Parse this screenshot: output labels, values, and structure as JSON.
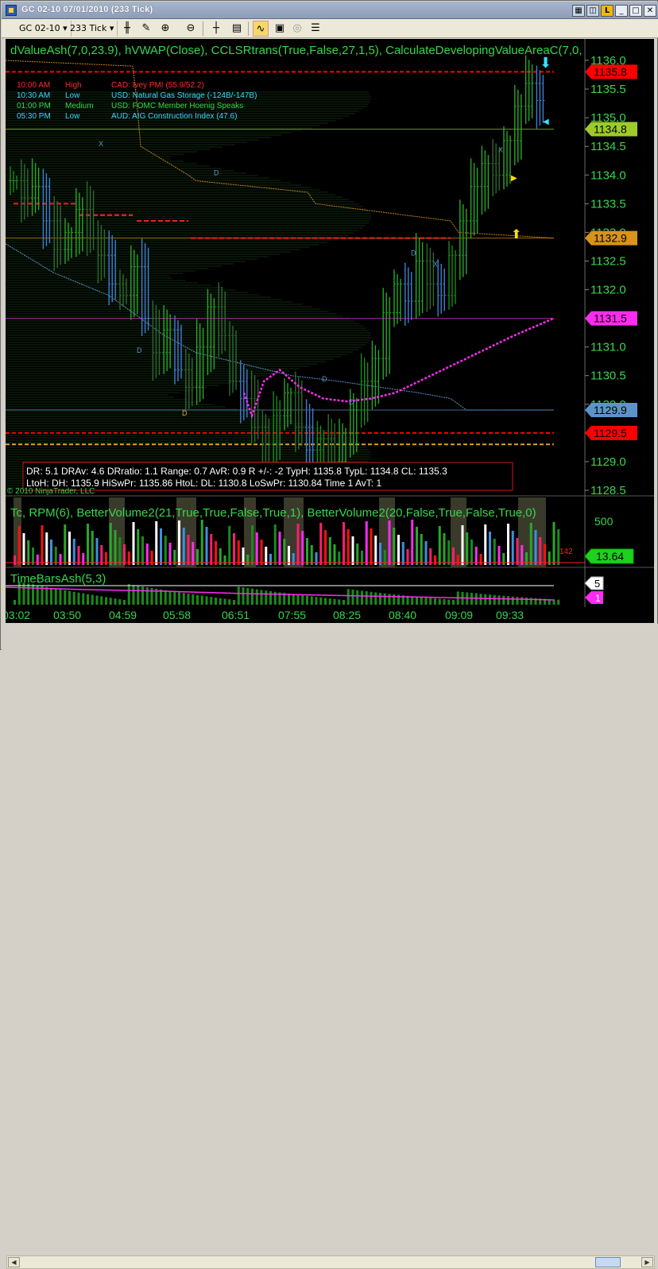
{
  "window": {
    "title": "GC 02-10  07/01/2010 (233 Tick)",
    "buttons": [
      "_",
      "□",
      "✕"
    ]
  },
  "toolbar": {
    "instrument": "GC 02-10",
    "interval": "233 Tick",
    "icons": [
      "bar-style-icon",
      "pencil-draw-icon",
      "zoom-in-icon",
      "zoom-out-icon",
      "crosshair-icon",
      "properties-icon",
      "indicator-icon",
      "strategy-icon",
      "circle-icon",
      "list-icon"
    ]
  },
  "price_panel": {
    "indicators_label": "dValueAsh(7,0,23.9), hVWAP(Close), CCLSRtrans(True,False,27,1,5), CalculateDevelopingValueAreaC(7,0,",
    "copyright": "© 2010 NinjaTrader, LLC",
    "news": [
      {
        "time": "10:00 AM",
        "impact": "High",
        "text": "CAD: Ivey PMI (55.9/52.2)",
        "color": "#ff2b2b"
      },
      {
        "time": "10:30 AM",
        "impact": "Low",
        "text": "USD: Natural Gas Storage (-124B/-147B)",
        "color": "#39d8ff"
      },
      {
        "time": "01:00 PM",
        "impact": "Medium",
        "text": "USD: FOMC Member Hoenig Speaks",
        "color": "#35d64a"
      },
      {
        "time": "05:30 PM",
        "impact": "Low",
        "text": "AUD: AIG Construction Index (47.6)",
        "color": "#39d8ff"
      }
    ],
    "stats_line1": "DR: 5.1 DRAv: 4.6 DRratio: 1.1 Range: 0.7 AvR: 0.9 R +/-: -2 TypH: 1135.8 TypL: 1134.8 CL: 1135.3",
    "stats_line2": "LtoH:  DH: 1135.9 HiSwPr: 1135.86 HtoL:  DL: 1130.8 LoSwPr: 1130.84 Time 1 AvT: 1",
    "markers": [
      "D",
      "D",
      "D",
      "D",
      "D",
      "X",
      "X",
      "X",
      "D"
    ]
  },
  "price_tags": [
    {
      "value": "1135.8",
      "color": "#ff0000",
      "text_color": "#000000"
    },
    {
      "value": "1134.8",
      "color": "#9ecb2a",
      "text_color": "#000000"
    },
    {
      "value": "1132.9",
      "color": "#d8931d",
      "text_color": "#000000"
    },
    {
      "value": "1131.5",
      "color": "#ff2bf0",
      "text_color": "#000000"
    },
    {
      "value": "1129.9",
      "color": "#5e93c9",
      "text_color": "#000000"
    },
    {
      "value": "1129.5",
      "color": "#ff0000",
      "text_color": "#000000"
    }
  ],
  "volume_panel": {
    "label": "Tc,  RPM(6),  BetterVolume2(21,True,True,False,True,1),  BetterVolume2(20,False,True,False,True,0)",
    "axis_value": "500",
    "tag": "13.64",
    "count_label": "142"
  },
  "timebars_panel": {
    "label": "TimeBarsAsh(5,3)",
    "tag_top": "5",
    "tag_bottom": "1"
  },
  "chart_data": {
    "type": "candlestick",
    "y_axis_ticks": [
      "1136.0",
      "1135.5",
      "1135.0",
      "1134.5",
      "1134.0",
      "1133.5",
      "1133.0",
      "1132.5",
      "1132.0",
      "1131.5",
      "1131.0",
      "1130.5",
      "1130.0",
      "1129.5",
      "1129.0",
      "1128.5"
    ],
    "ylim": [
      1128.5,
      1136.0
    ],
    "x_tick_labels": [
      "03:02",
      "03:50",
      "04:59",
      "05:58",
      "06:51",
      "07:55",
      "08:25",
      "08:40",
      "09:09",
      "09:33"
    ],
    "levels": [
      {
        "value": 1135.8,
        "style": "dashed",
        "color": "#ff0000"
      },
      {
        "value": 1134.8,
        "style": "solid",
        "color": "#9ecb2a"
      },
      {
        "value": 1132.9,
        "style": "solid",
        "color": "#d8931d"
      },
      {
        "value": 1131.5,
        "style": "solid",
        "color": "#ff2bf0"
      },
      {
        "value": 1129.9,
        "style": "solid",
        "color": "#5e93c9"
      },
      {
        "value": 1129.5,
        "style": "dashed",
        "color": "#ff0000"
      },
      {
        "value": 1129.3,
        "style": "dashed",
        "color": "#e4a022"
      }
    ],
    "close_series": [
      1133.9,
      1133.6,
      1133.8,
      1133.2,
      1132.7,
      1133.0,
      1133.4,
      1132.9,
      1132.6,
      1132.1,
      1131.9,
      1132.4,
      1131.5,
      1130.9,
      1131.3,
      1130.6,
      1130.3,
      1131.0,
      1131.7,
      1131.2,
      1130.4,
      1130.1,
      1129.6,
      1129.3,
      1129.8,
      1130.2,
      1129.6,
      1129.2,
      1129.4,
      1129.0,
      1129.5,
      1129.9,
      1130.4,
      1130.8,
      1131.6,
      1132.1,
      1131.8,
      1132.5,
      1132.1,
      1131.9,
      1132.6,
      1133.2,
      1133.8,
      1134.2,
      1134.0,
      1134.6,
      1135.2,
      1135.6,
      1135.3
    ],
    "value_area_line": [
      1130.6,
      1130.4,
      1130.2,
      1130.0,
      1129.95,
      1129.9,
      1130.0,
      1130.2,
      1130.4,
      1130.6,
      1130.8,
      1131.0,
      1131.2,
      1131.35,
      1131.5
    ]
  }
}
